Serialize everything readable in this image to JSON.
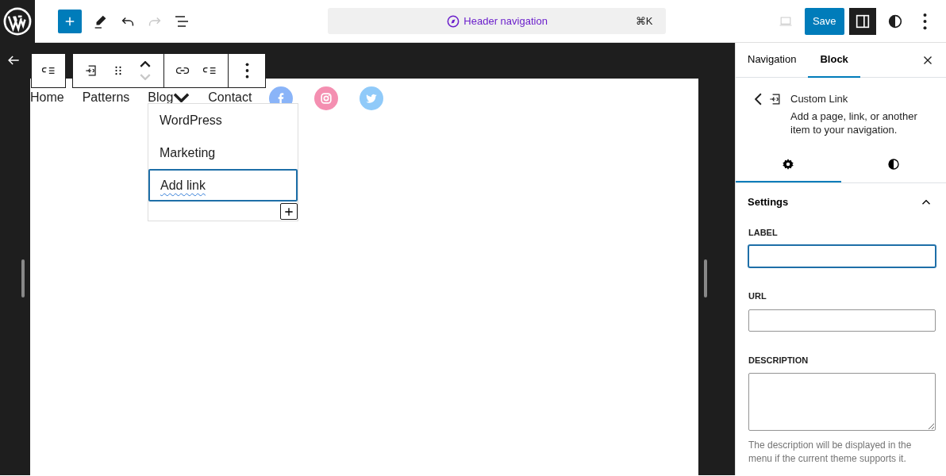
{
  "topbar": {
    "history": [
      {
        "kind": "undo",
        "disabled": false
      },
      {
        "kind": "redo",
        "disabled": true
      }
    ],
    "command": {
      "label": "Header navigation",
      "shortcut": "⌘K"
    },
    "save": "Save",
    "sidebar_open": true
  },
  "block_toolbar": {
    "mover": [
      {
        "kind": "up",
        "disabled": false
      },
      {
        "kind": "down",
        "disabled": true
      }
    ]
  },
  "navigation": {
    "items": [
      {
        "label": "Home",
        "has_submenu": false
      },
      {
        "label": "Patterns",
        "has_submenu": false
      },
      {
        "label": "Blog",
        "has_submenu": true
      },
      {
        "label": "Contact",
        "has_submenu": false
      }
    ],
    "social": [
      {
        "kind": "facebook",
        "color": "#8ab4f8"
      },
      {
        "kind": "instagram",
        "color": "#f48fb1"
      },
      {
        "kind": "twitter",
        "color": "#90caf9"
      }
    ],
    "submenu": [
      {
        "label": "WordPress",
        "selected": false
      },
      {
        "label": "Marketing",
        "selected": false
      },
      {
        "label": "Add link",
        "selected": true
      }
    ]
  },
  "sidebar": {
    "tabs": [
      {
        "label": "Navigation",
        "selected": false
      },
      {
        "label": "Block",
        "selected": true
      }
    ],
    "block": {
      "title": "Custom Link",
      "description": "Add a page, link, or another item to your navigation."
    },
    "subtabs": [
      {
        "kind": "settings",
        "selected": true
      },
      {
        "kind": "styles",
        "selected": false
      }
    ],
    "panel": {
      "title": "Settings",
      "expanded": true,
      "fields": [
        {
          "label": "LABEL",
          "kind": "input",
          "focused": true
        },
        {
          "label": "URL",
          "kind": "input",
          "focused": false
        },
        {
          "label": "DESCRIPTION",
          "kind": "textarea",
          "focused": false,
          "help": "The description will be displayed in the menu if the current theme supports it."
        }
      ]
    }
  }
}
